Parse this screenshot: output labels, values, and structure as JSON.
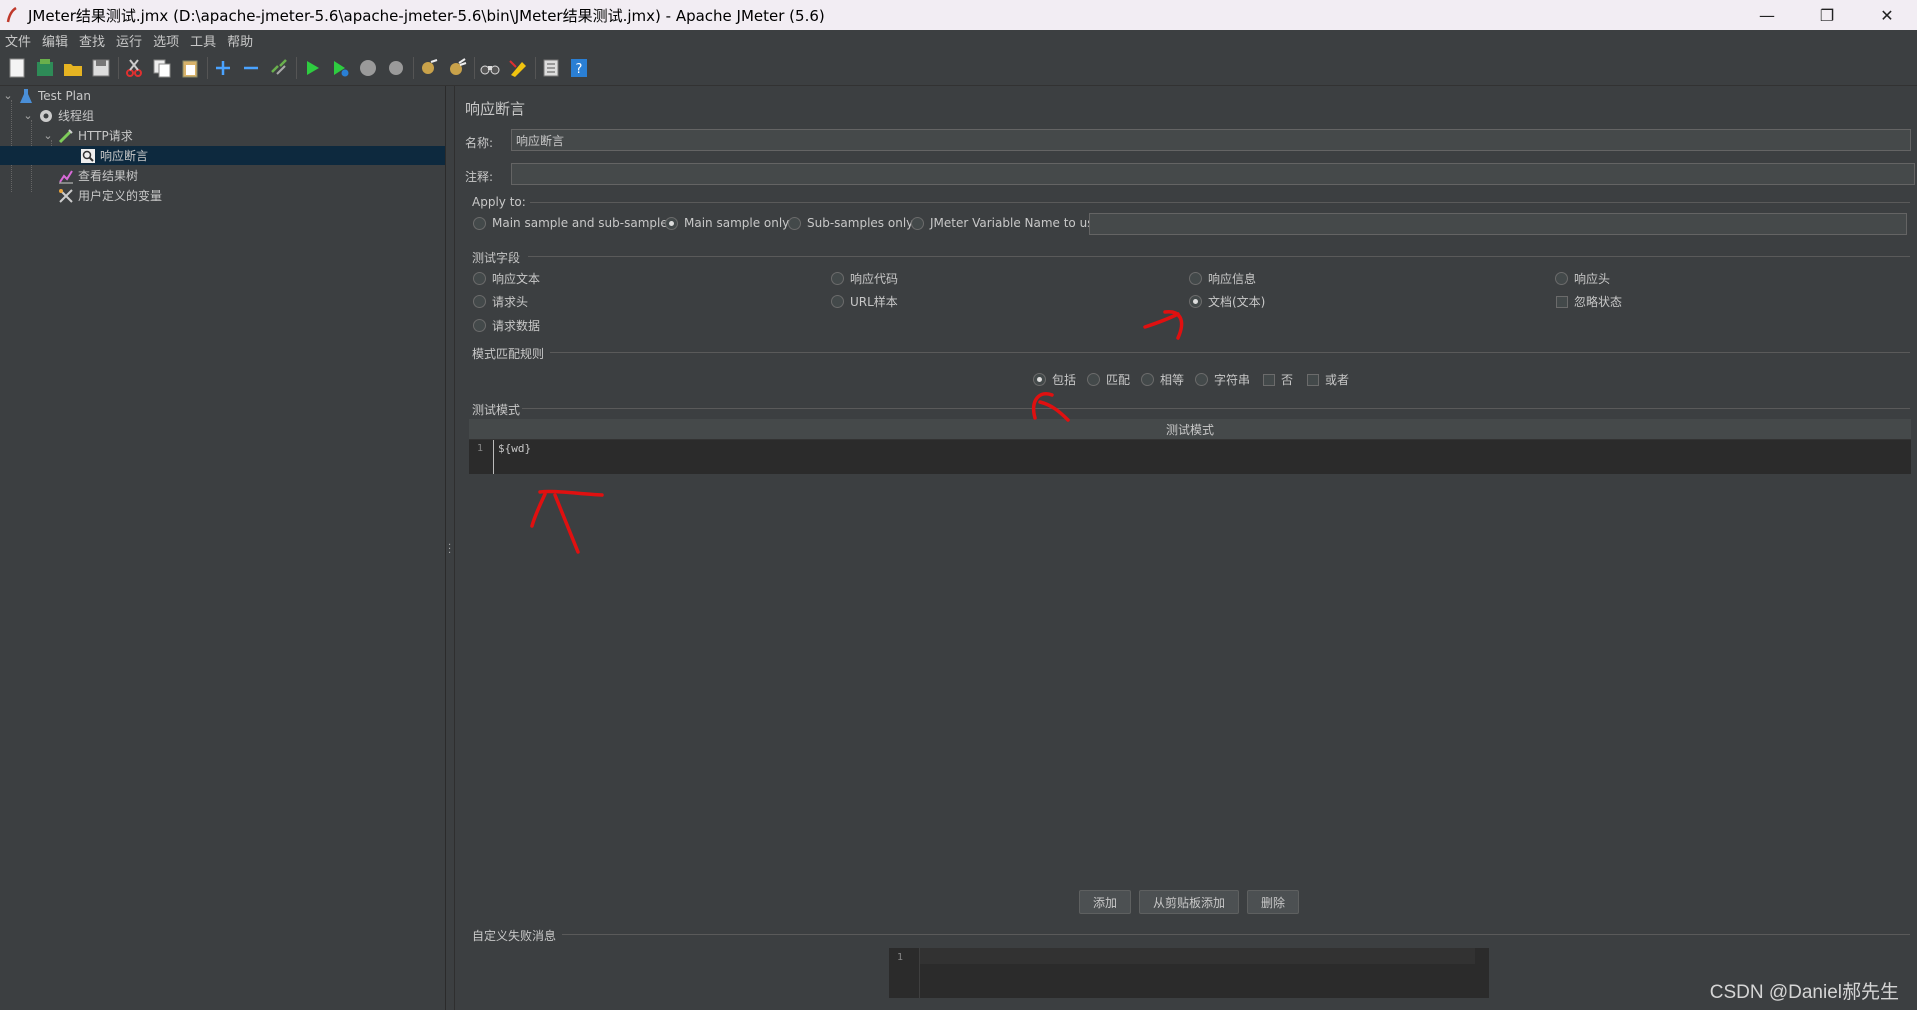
{
  "window": {
    "title": "JMeter结果测试.jmx (D:\\apache-jmeter-5.6\\apache-jmeter-5.6\\bin\\JMeter结果测试.jmx) - Apache JMeter (5.6)",
    "minimize": "—",
    "restore": "❐",
    "close": "✕"
  },
  "menu": [
    "文件",
    "编辑",
    "查找",
    "运行",
    "选项",
    "工具",
    "帮助"
  ],
  "tree": {
    "test_plan": "Test Plan",
    "thread_group": "线程组",
    "http_request": "HTTP请求",
    "response_assertion": "响应断言",
    "view_results_tree": "查看结果树",
    "user_vars": "用户定义的变量"
  },
  "assertion": {
    "title": "响应断言",
    "name_label": "名称:",
    "name_value": "响应断言",
    "comment_label": "注释:",
    "comment_value": "",
    "apply_to": {
      "label": "Apply to:",
      "options": [
        "Main sample and sub-samples",
        "Main sample only",
        "Sub-samples only",
        "JMeter Variable Name to use"
      ],
      "selected": 1,
      "var_value": ""
    },
    "field_to_test": {
      "label": "测试字段",
      "opt_resp_text": "响应文本",
      "opt_resp_code": "响应代码",
      "opt_resp_msg": "响应信息",
      "opt_resp_headers": "响应头",
      "opt_req_headers": "请求头",
      "opt_url": "URL样本",
      "opt_document": "文档(文本)",
      "opt_ignore_status": "忽略状态",
      "opt_req_data": "请求数据",
      "selected": "文档(文本)"
    },
    "pattern_rules": {
      "label": "模式匹配规则",
      "contains": "包括",
      "matches": "匹配",
      "equals": "相等",
      "substring": "字符串",
      "not": "否",
      "or": "或者",
      "selected": "包括"
    },
    "patterns": {
      "label": "测试模式",
      "column": "测试模式",
      "line_no": "1",
      "value": "${wd}"
    },
    "buttons": {
      "add": "添加",
      "add_clipboard": "从剪贴板添加",
      "delete": "删除"
    },
    "custom_msg": {
      "label": "自定义失败消息",
      "line_no": "1",
      "value": ""
    }
  },
  "watermark": "CSDN @Daniel郝先生",
  "colors": {
    "background": "#3c3f41",
    "selection": "#0d293e",
    "annotation": "#e01010"
  }
}
